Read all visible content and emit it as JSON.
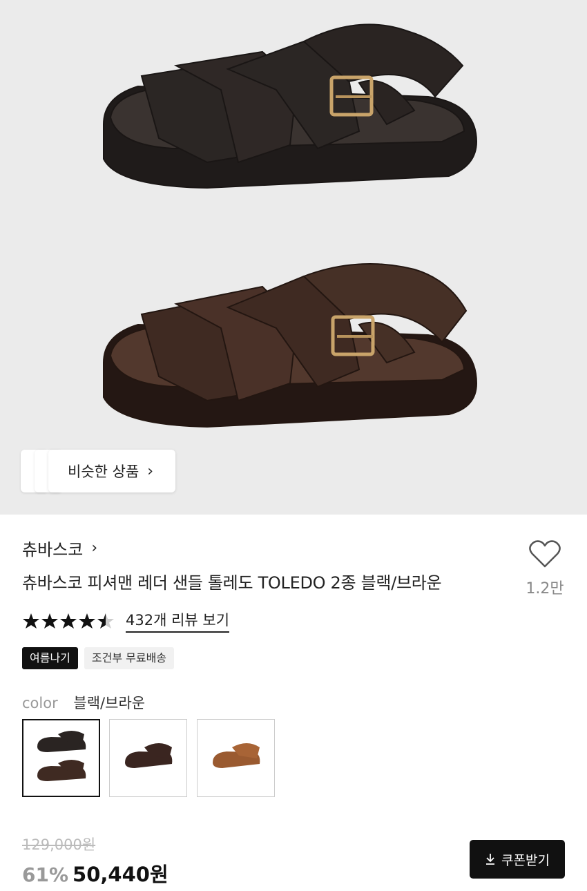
{
  "similar": {
    "label": "비슷한 상품"
  },
  "product": {
    "brand": "츄바스코",
    "title": "츄바스코 피셔맨 레더 샌들 톨레도 TOLEDO 2종 블랙/브라운",
    "likes": "1.2만",
    "rating": 4.5,
    "review_label": "432개 리뷰 보기",
    "tags": [
      "여름나기",
      "조건부 무료배송"
    ]
  },
  "color": {
    "label": "color",
    "value": "블랙/브라운"
  },
  "swatches": [
    "black-brown",
    "brown",
    "tan"
  ],
  "price": {
    "original": "129,000원",
    "discount": "61%",
    "sale": "50,440원"
  },
  "coupon": {
    "label": "쿠폰받기"
  },
  "icons": {
    "heart": "heart-icon",
    "chevron": "chevron-right-icon",
    "download": "download-icon",
    "star": "star-icon"
  }
}
